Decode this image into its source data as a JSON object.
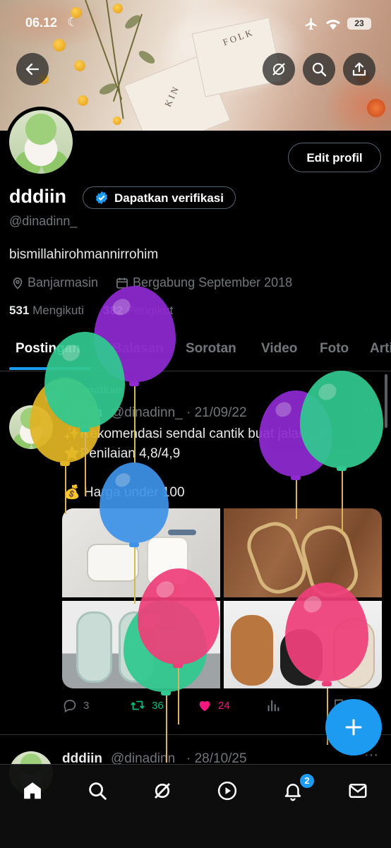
{
  "status_bar": {
    "time": "06.12",
    "battery": "23"
  },
  "banner": {
    "book_text_1": "FOLK",
    "book_text_2": "KIN"
  },
  "profile": {
    "edit_label": "Edit profil",
    "name": "dddiin",
    "verify_label": "Dapatkan verifikasi",
    "handle": "@dinadinn_",
    "bio": "bismillahirohmannirrohim",
    "location": "Banjarmasin",
    "joined": "Bergabung September 2018",
    "following_count": "531",
    "following_label": "Mengikuti",
    "followers_count": "382",
    "followers_label": "Pengikut"
  },
  "tabs": [
    "Postingan",
    "Balasan",
    "Sorotan",
    "Video",
    "Foto",
    "Artikel"
  ],
  "pinned_label": "Disematkan",
  "tweet": {
    "name": "dddiin",
    "handle_date": "@dinadinn_ · 21/09/22",
    "line1": "✨Rekomendasi sendal cantik buat jalan ✨",
    "line2": "⭐Penilaian 4,8/4,9",
    "line3": "💰 Harga under 100",
    "replies": "3",
    "retweets": "36",
    "likes": "24"
  },
  "tweet2": {
    "name": "dddiin",
    "handle_date": "@dinadinn_ · 28/10/25"
  },
  "nav": {
    "notification_badge": "2"
  },
  "icons": [
    "back-arrow-icon",
    "grok-icon",
    "search-icon",
    "share-icon",
    "location-pin-icon",
    "calendar-icon",
    "verified-badge-icon",
    "reply-icon",
    "retweet-icon",
    "heart-icon",
    "views-icon",
    "bookmark-icon",
    "compose-plus-icon",
    "home-icon",
    "explore-icon",
    "video-play-icon",
    "bell-icon",
    "mail-icon"
  ],
  "colors": {
    "accent": "#1d9bf0",
    "retweet": "#00ba7c",
    "like": "#f91880",
    "background": "#000000"
  }
}
